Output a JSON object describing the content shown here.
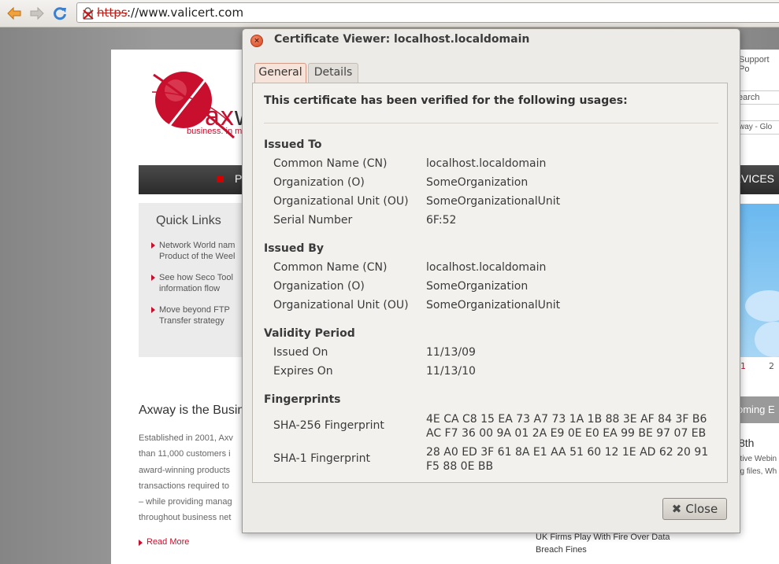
{
  "browser": {
    "url_scheme": "https",
    "url_rest": "://www.valicert.com"
  },
  "webpage": {
    "logo_text_prefix": "ax",
    "logo_text_rest": "w",
    "logo_tagline": "business. in m",
    "nav_left": "P",
    "nav_right": "RVICES",
    "quick_links_title": "Quick Links",
    "quick_links": [
      {
        "line1": "Network World nam",
        "line2": "Product of the Weel"
      },
      {
        "line1": "See how Seco Tool",
        "line2": "information flow"
      },
      {
        "line1": "Move beyond FTP",
        "line2": "Transfer strategy"
      }
    ],
    "headline": "Axway is the Busin",
    "body_lines": [
      "Established in 2001, Axv",
      "than 11,000 customers i",
      "award-winning products",
      "transactions required to",
      "– while providing manag",
      "throughout business net"
    ],
    "read_more": "Read More",
    "support_link": "Support Po",
    "search_placeholder": "earch",
    "region_select": "xway - Glo",
    "pager_1": "1",
    "pager_2": "2",
    "upcoming_events": "oming E",
    "event_date": "8th",
    "event_desc_1": "utive Webin",
    "event_desc_2": "ng files, Wh",
    "news_1": "UK Firms Play With Fire Over Data",
    "news_2": "Breach Fines"
  },
  "dialog": {
    "title": "Certificate Viewer: localhost.localdomain",
    "tabs": [
      "General",
      "Details"
    ],
    "active_tab": "General",
    "usage_title": "This certificate has been verified for the following usages:",
    "issued_to": {
      "heading": "Issued To",
      "rows": [
        {
          "label": "Common Name (CN)",
          "value": "localhost.localdomain"
        },
        {
          "label": "Organization (O)",
          "value": "SomeOrganization"
        },
        {
          "label": "Organizational Unit (OU)",
          "value": "SomeOrganizationalUnit"
        },
        {
          "label": "Serial Number",
          "value": "6F:52"
        }
      ]
    },
    "issued_by": {
      "heading": "Issued By",
      "rows": [
        {
          "label": "Common Name (CN)",
          "value": "localhost.localdomain"
        },
        {
          "label": "Organization (O)",
          "value": "SomeOrganization"
        },
        {
          "label": "Organizational Unit (OU)",
          "value": "SomeOrganizationalUnit"
        }
      ]
    },
    "validity": {
      "heading": "Validity Period",
      "rows": [
        {
          "label": "Issued On",
          "value": "11/13/09"
        },
        {
          "label": "Expires On",
          "value": "11/13/10"
        }
      ]
    },
    "fingerprints": {
      "heading": "Fingerprints",
      "sha256_label": "SHA-256 Fingerprint",
      "sha256_line1": "4E CA C8 15 EA 73 A7 73 1A 1B 88 3E AF 84 3F B6",
      "sha256_line2": "AC F7 36 00 9A 01 2A E9 0E E0 EA 99 BE 97 07 EB",
      "sha1_label": "SHA-1 Fingerprint",
      "sha1_line1": "28 A0 ED 3F 61 8A E1 AA 51 60 12 1E AD 62 20 91",
      "sha1_line2": "F5 88 0E BB"
    },
    "close_label": "Close"
  },
  "colors": {
    "brand_red": "#c8102e",
    "insecure_scheme": "#b8211b",
    "active_tab_bg": "#f6e3da"
  },
  "icons": [
    "back-arrow-icon",
    "forward-arrow-icon",
    "reload-icon",
    "broken-lock-icon",
    "window-close-icon",
    "close-x-icon"
  ]
}
